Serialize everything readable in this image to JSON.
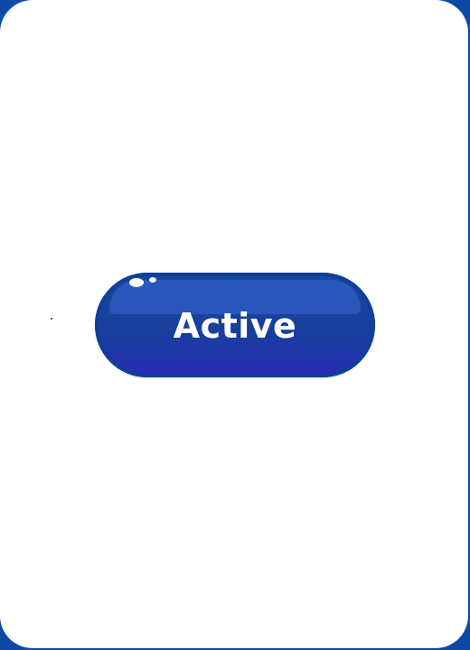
{
  "button": {
    "label": "Active",
    "state": "active"
  },
  "colors": {
    "frame": "#0d4aa6",
    "card": "#ffffff",
    "button_top": "#17499f",
    "button_bottom": "#2a2bb6",
    "highlight": "#2c59c0",
    "text": "#ffffff"
  }
}
